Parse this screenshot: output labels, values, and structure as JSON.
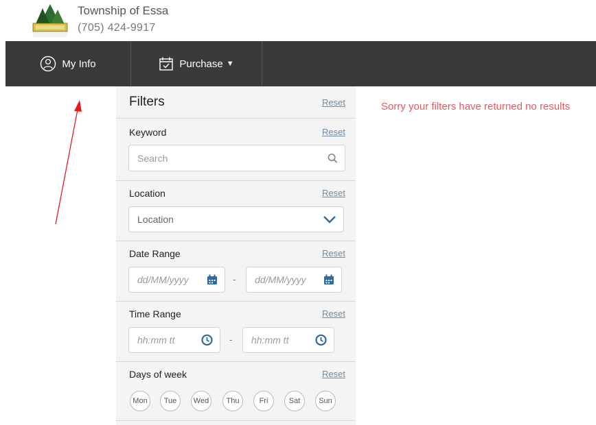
{
  "header": {
    "org_name": "Township of Essa",
    "phone": "(705) 424-9917"
  },
  "nav": {
    "my_info": "My Info",
    "purchase": "Purchase",
    "purchase_caret": "▼"
  },
  "filters": {
    "title": "Filters",
    "reset": "Reset",
    "keyword": {
      "label": "Keyword",
      "reset": "Reset",
      "placeholder": "Search"
    },
    "location": {
      "label": "Location",
      "reset": "Reset",
      "placeholder": "Location"
    },
    "date_range": {
      "label": "Date Range",
      "reset": "Reset",
      "from_placeholder": "dd/MM/yyyy",
      "to_placeholder": "dd/MM/yyyy",
      "separator": "-"
    },
    "time_range": {
      "label": "Time Range",
      "reset": "Reset",
      "from_placeholder": "hh:mm tt",
      "to_placeholder": "hh:mm tt",
      "separator": "-"
    },
    "days_of_week": {
      "label": "Days of week",
      "reset": "Reset",
      "days": [
        "Mon",
        "Tue",
        "Wed",
        "Thu",
        "Fri",
        "Sat",
        "Sun"
      ]
    }
  },
  "results": {
    "message": "Sorry your filters have returned no results"
  },
  "colors": {
    "nav_bg": "#3a3a3a",
    "sidebar_bg": "#f4f4f4",
    "link": "#6f8aa6",
    "error": "#e8585c",
    "icon_blue": "#2f6aa0",
    "annotation": "#e8191b"
  }
}
